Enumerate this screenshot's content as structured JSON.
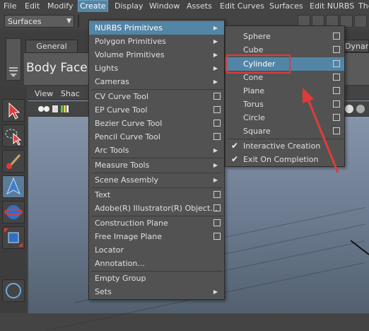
{
  "menubar": {
    "items": [
      "File",
      "Edit",
      "Modify",
      "Create",
      "Display",
      "Window",
      "Assets",
      "Edit Curves",
      "Surfaces",
      "Edit NURBS",
      "The"
    ]
  },
  "toolbar": {
    "mode": "Surfaces"
  },
  "shelf": {
    "tab_general": "General",
    "tab_dynamics": "Dynam",
    "label": "Body Face"
  },
  "viewport": {
    "menu": [
      "View",
      "Shac"
    ]
  },
  "create_menu": {
    "items": [
      "NURBS Primitives",
      "Polygon Primitives",
      "Volume Primitives",
      "Lights",
      "Cameras",
      "CV Curve Tool",
      "EP Curve Tool",
      "Bezier Curve Tool",
      "Pencil Curve Tool",
      "Arc Tools",
      "Measure Tools",
      "Scene Assembly",
      "Text",
      "Adobe(R) Illustrator(R) Object...",
      "Construction Plane",
      "Free Image Plane",
      "Locator",
      "Annotation...",
      "Empty Group",
      "Sets"
    ]
  },
  "nurbs_submenu": {
    "items": [
      "Sphere",
      "Cube",
      "Cylinder",
      "Cone",
      "Plane",
      "Torus",
      "Circle",
      "Square"
    ],
    "checks": [
      "Interactive Creation",
      "Exit On Completion"
    ]
  },
  "colors": {
    "menu_highlight": "#5285a6",
    "annotation": "#e23a3a"
  }
}
